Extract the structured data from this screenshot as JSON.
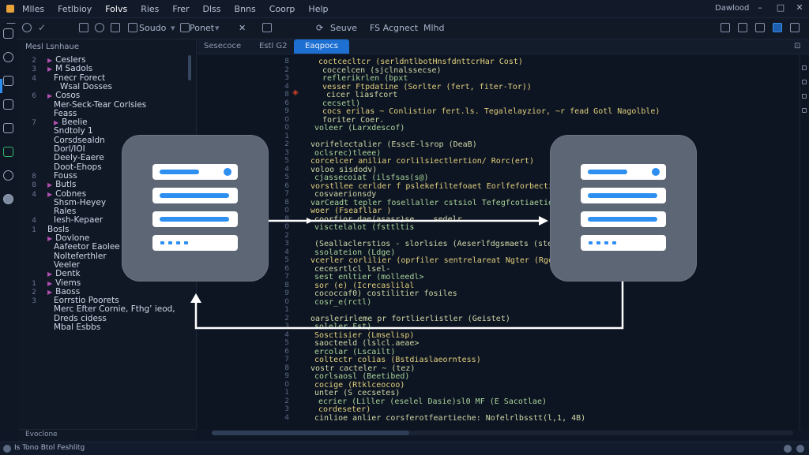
{
  "menubar": {
    "items": [
      "Mlles",
      "Fetlbioy",
      "Folvs",
      "Ries",
      "Frer",
      "Dlss",
      "Bnns",
      "Coorp",
      "Help"
    ],
    "active_index": 2,
    "window_title": "Dawlood"
  },
  "toolbar": {
    "item_1": "Soudo",
    "item_2": "Ponet",
    "item_3": "Seuve",
    "item_4": "FS Acgnect",
    "item_5": "Mlhd"
  },
  "sidebar": {
    "header": "Mesl Lsnhaue",
    "rows": [
      {
        "ln": "2",
        "text": "Ceslers",
        "indent": 1,
        "arrow": true
      },
      {
        "ln": "3",
        "text": "M Sadols",
        "indent": 1,
        "arrow": true
      },
      {
        "ln": "4",
        "text": "Fnecr Forect",
        "indent": 2,
        "arrow": false
      },
      {
        "ln": "",
        "text": "Wsal Dosses",
        "indent": 3,
        "arrow": false
      },
      {
        "ln": "6",
        "text": "Cosos",
        "indent": 1,
        "arrow": true
      },
      {
        "ln": "",
        "text": "Mer-Seck-Tear Corlsies",
        "indent": 2,
        "arrow": false
      },
      {
        "ln": "",
        "text": "Feass",
        "indent": 2,
        "arrow": false
      },
      {
        "ln": "7",
        "text": "Beelie",
        "indent": 2,
        "arrow": true
      },
      {
        "ln": "",
        "text": "Sndtoly 1",
        "indent": 2,
        "arrow": false
      },
      {
        "ln": "",
        "text": "Corsdsealdn",
        "indent": 2,
        "arrow": false
      },
      {
        "ln": "",
        "text": "Dorl/IOI",
        "indent": 2,
        "arrow": false
      },
      {
        "ln": "",
        "text": "Deely-Eaere",
        "indent": 2,
        "arrow": false
      },
      {
        "ln": "",
        "text": "Doot-Ehops",
        "indent": 2,
        "arrow": false
      },
      {
        "ln": "8",
        "text": "Fouss",
        "indent": 2,
        "arrow": false
      },
      {
        "ln": "8",
        "text": "Butls",
        "indent": 1,
        "arrow": true
      },
      {
        "ln": "4",
        "text": "Cobnes",
        "indent": 1,
        "arrow": true
      },
      {
        "ln": "",
        "text": "Shsm-Heyey",
        "indent": 2,
        "arrow": false
      },
      {
        "ln": "",
        "text": "Rales",
        "indent": 2,
        "arrow": false
      },
      {
        "ln": "4",
        "text": "Iesh-Kepaer",
        "indent": 2,
        "arrow": false
      },
      {
        "ln": "1",
        "text": "Bosls",
        "indent": 1,
        "arrow": false
      },
      {
        "ln": "",
        "text": "Dovlone",
        "indent": 1,
        "arrow": true
      },
      {
        "ln": "",
        "text": "Aafeetor Eaolee",
        "indent": 2,
        "arrow": false
      },
      {
        "ln": "",
        "text": "Nolteferthler",
        "indent": 2,
        "arrow": false
      },
      {
        "ln": "",
        "text": "Veeler",
        "indent": 2,
        "arrow": false
      },
      {
        "ln": "",
        "text": "Dentk",
        "indent": 1,
        "arrow": true
      },
      {
        "ln": "1",
        "text": "Viems",
        "indent": 1,
        "arrow": true
      },
      {
        "ln": "2",
        "text": "Baoss",
        "indent": 1,
        "arrow": true
      },
      {
        "ln": "3",
        "text": "Eorrstio Poorets",
        "indent": 2,
        "arrow": false
      },
      {
        "ln": "",
        "text": "Merc Efter Cornie, Fthg’ ieod,",
        "indent": 2,
        "arrow": false
      },
      {
        "ln": "",
        "text": "Dreds cidess",
        "indent": 2,
        "arrow": false
      },
      {
        "ln": "",
        "text": "Mbal Esbbs",
        "indent": 2,
        "arrow": false
      }
    ],
    "panel_label": "Evoclone"
  },
  "tabs": [
    {
      "label": "Sesecoce",
      "active": false
    },
    {
      "label": "Estl G2",
      "active": false
    },
    {
      "label": "Eaqpocs",
      "active": true
    }
  ],
  "editor": {
    "lines": [
      {
        "n": "8",
        "text": "coctcecltcr (serldntlbotHnsfdnttcrHar Cost)",
        "indent": 5
      },
      {
        "n": "2",
        "text": "coccelcen (sjclnalssecse)",
        "indent": 6
      },
      {
        "n": "3",
        "text": "reflerikrlen (bpxt",
        "indent": 6
      },
      {
        "n": "4",
        "text": "vesser Ftpdatine (Sorlter (fert, fiter-Tor))",
        "indent": 6
      },
      {
        "n": "8",
        "text": "cicer liasfcort",
        "indent": 7
      },
      {
        "n": "6",
        "text": "cecsetl)",
        "indent": 6
      },
      {
        "n": "9",
        "text": "cocs erilas ~ Conlistior fert.ls. Tegalelayzior, ~r fead Gotl Nagolble)",
        "indent": 6
      },
      {
        "n": "0",
        "text": "foriter Coer.",
        "indent": 6
      },
      {
        "n": "0",
        "text": "voleer (Larxdescof)",
        "indent": 4
      },
      {
        "n": "1",
        "text": "",
        "indent": 0
      },
      {
        "n": "2",
        "text": "vorifelectalier (EsscE-lsrop (DeaB)",
        "indent": 3
      },
      {
        "n": "3",
        "text": "oclsrec)tleee)",
        "indent": 4
      },
      {
        "n": "5",
        "text": "corcelcer aniliar corlilsiectlertion/ Rorc(ert)",
        "indent": 3
      },
      {
        "n": "4",
        "text": "voloo sisdodv)",
        "indent": 3
      },
      {
        "n": "5",
        "text": "cjassecoiat (ilsfsas(s@)",
        "indent": 4
      },
      {
        "n": "6",
        "text": "vorstllee cerlder f pslekefiltefoaet Eorlfeforbectiol",
        "indent": 3
      },
      {
        "n": "7",
        "text": "cosvaerionsdy",
        "indent": 4
      },
      {
        "n": "8",
        "text": "varCeadt tepler fosellaller cstsiol Tefegfcotiaetioi",
        "indent": 3
      },
      {
        "n": "0",
        "text": "woer (Fseafllar )",
        "indent": 3
      },
      {
        "n": "8",
        "text": "coorfior dae(asasr)se ...sedelr",
        "indent": 4
      },
      {
        "n": "0",
        "text": "visctelalot (fsttltis",
        "indent": 4
      },
      {
        "n": "2",
        "text": "",
        "indent": 0
      },
      {
        "n": "3",
        "text": "(Seallaclerstios - slorlsies (Aeserlfdgsmaets (ste)",
        "indent": 4
      },
      {
        "n": "4",
        "text": "ssolateion (Ldge)",
        "indent": 4
      },
      {
        "n": "5",
        "text": "vcerler corlilier (oprfiler sentrelareat Ngter (Rgorsttuoser kastteleatt)",
        "indent": 3
      },
      {
        "n": "6",
        "text": "cecesrtlcl lsel-",
        "indent": 4
      },
      {
        "n": "7",
        "text": "sest enltier (molleedl>",
        "indent": 4
      },
      {
        "n": "8",
        "text": "sor (e) (Icrecaslilal",
        "indent": 4
      },
      {
        "n": "9",
        "text": "cococcaf0) costilitier fosiles",
        "indent": 4
      },
      {
        "n": "0",
        "text": "cosr_e(rctl)",
        "indent": 4
      },
      {
        "n": "1",
        "text": "",
        "indent": 0
      },
      {
        "n": "2",
        "text": "oarslerirleme pr fortlierlistler (Geistet)",
        "indent": 3
      },
      {
        "n": "3",
        "text": "soleler Fst)",
        "indent": 4
      },
      {
        "n": "4",
        "text": "Sosctisier (Lmselisp)",
        "indent": 4
      },
      {
        "n": "5",
        "text": "saocteeld (lslcl.aeae>",
        "indent": 4
      },
      {
        "n": "6",
        "text": "ercolar (Lscailt)",
        "indent": 4
      },
      {
        "n": "7",
        "text": "coltectr colias (Bstdiaslaeorntess)",
        "indent": 4
      },
      {
        "n": "8",
        "text": "vostr cacteler ~ (tez)",
        "indent": 3
      },
      {
        "n": "9",
        "text": "corlsaosl (Beetibed)",
        "indent": 4
      },
      {
        "n": "0",
        "text": "cocige (Rtklceocoo)",
        "indent": 4
      },
      {
        "n": "1",
        "text": "unter (S cecsetes)",
        "indent": 4
      },
      {
        "n": "2",
        "text": "ecrier (Liller (eselel Dasie)sl0 MF (E Sacotlae)",
        "indent": 5
      },
      {
        "n": "3",
        "text": "cordeseter)",
        "indent": 5
      },
      {
        "n": "4",
        "text": "cinlioe anlier corsferotfeartieche: Nofelrlbsstt(l,1, 4B)",
        "indent": 4
      }
    ]
  },
  "diagram": {
    "left_server_label": "",
    "right_server_label": ""
  },
  "statusbar": {
    "text": "Is Tono Btol Feshlitg"
  },
  "colors": {
    "accent": "#1d6fd1",
    "server_blue": "#2d8ff0",
    "card_gray": "#5d6674",
    "background": "#0f1726"
  },
  "icons": {
    "activity": [
      "files-icon",
      "search-icon",
      "source-control-icon",
      "debug-icon",
      "extensions-icon",
      "remote-icon",
      "chat-icon",
      "account-icon"
    ],
    "toolbar": [
      "new-file-icon",
      "open-icon",
      "save-icon",
      "terminal-icon",
      "settings-icon"
    ]
  }
}
